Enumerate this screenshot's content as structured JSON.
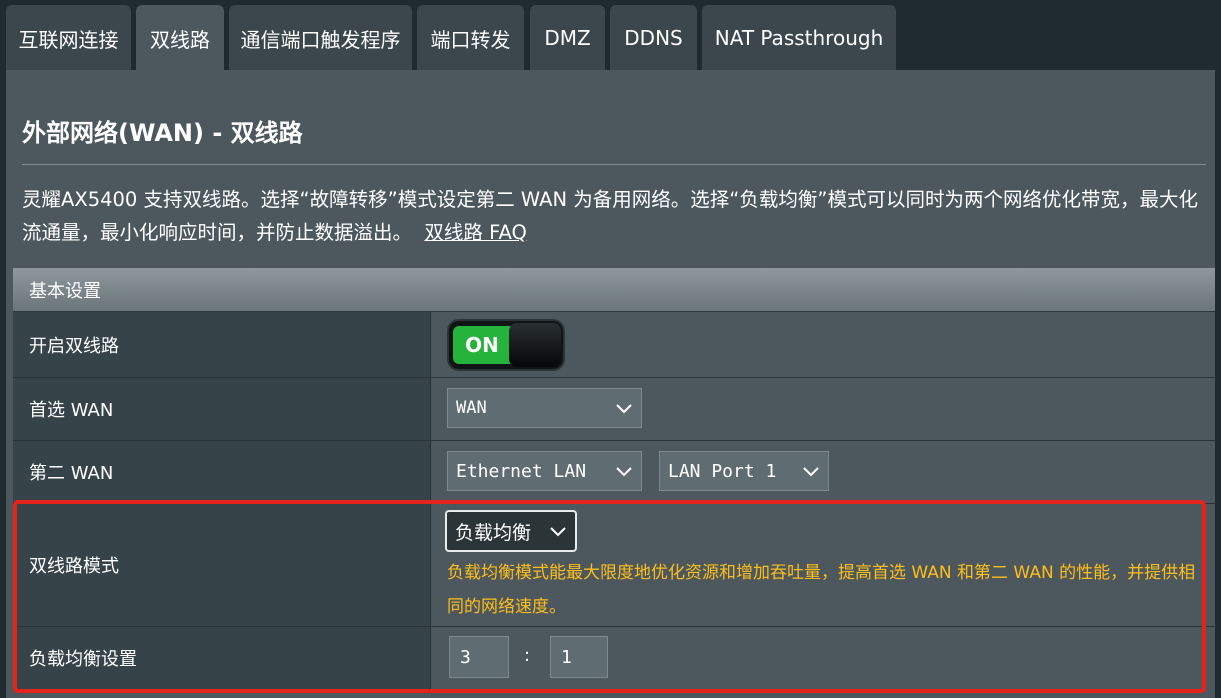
{
  "tabs": [
    {
      "label": "互联网连接",
      "active": false
    },
    {
      "label": "双线路",
      "active": true
    },
    {
      "label": "通信端口触发程序",
      "active": false
    },
    {
      "label": "端口转发",
      "active": false
    },
    {
      "label": "DMZ",
      "active": false
    },
    {
      "label": "DDNS",
      "active": false
    },
    {
      "label": "NAT Passthrough",
      "active": false
    }
  ],
  "page": {
    "title": "外部网络(WAN) - 双线路",
    "description": "灵耀AX5400 支持双线路。选择“故障转移”模式设定第二 WAN 为备用网络。选择“负载均衡”模式可以同时为两个网络优化带宽，最大化流通量，最小化响应时间，并防止数据溢出。",
    "faq_link": "双线路 FAQ"
  },
  "section": {
    "header": "基本设置",
    "enable_dual_wan": {
      "label": "开启双线路",
      "toggle_text": "ON",
      "state": "on"
    },
    "primary_wan": {
      "label": "首选 WAN",
      "value": "WAN"
    },
    "secondary_wan": {
      "label": "第二 WAN",
      "type_value": "Ethernet LAN",
      "port_value": "LAN Port 1"
    },
    "dual_wan_mode": {
      "label": "双线路模式",
      "value": "负载均衡",
      "hint": "负载均衡模式能最大限度地优化资源和增加吞吐量，提高首选 WAN 和第二 WAN 的性能，并提供相同的网络速度。"
    },
    "load_balance": {
      "label": "负载均衡设置",
      "primary_ratio": "3",
      "separator": ":",
      "secondary_ratio": "1"
    }
  },
  "colors": {
    "background": "#202b2f",
    "panel": "#4c585d",
    "label_cell": "#36444a",
    "toggle_on": "#26b33c",
    "hint_text": "#ffbe1a",
    "highlight_border": "#e6221d"
  }
}
